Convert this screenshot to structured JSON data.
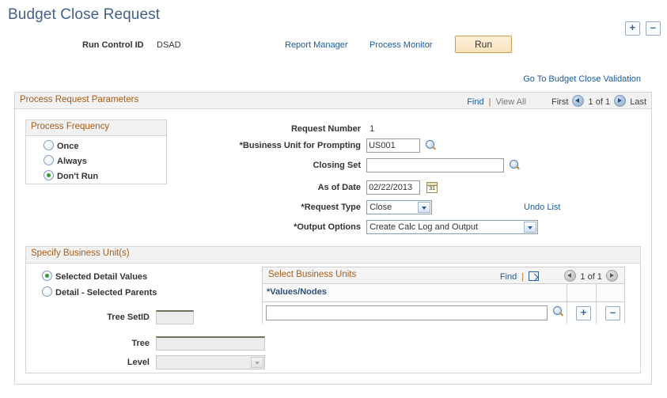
{
  "page": {
    "title": "Budget Close Request"
  },
  "toolbar": {
    "run_control_label": "Run Control ID",
    "run_control_value": "DSAD",
    "report_manager": "Report Manager",
    "process_monitor": "Process Monitor",
    "run_button": "Run",
    "goto_validation": "Go To Budget Close Validation"
  },
  "process_request": {
    "title": "Process Request Parameters",
    "find": "Find",
    "find_separator": "|",
    "view_all": "View All",
    "first": "First",
    "counter": "1 of 1",
    "last": "Last",
    "add_row": "+",
    "delete_row": "–"
  },
  "process_frequency": {
    "title": "Process Frequency",
    "options": [
      {
        "label": "Once",
        "selected": false
      },
      {
        "label": "Always",
        "selected": false
      },
      {
        "label": "Don't Run",
        "selected": true
      }
    ]
  },
  "fields": {
    "request_number_label": "Request Number",
    "request_number_value": "1",
    "business_unit_label": "Business Unit for Prompting",
    "business_unit_value": "US001",
    "closing_set_label": "Closing Set",
    "closing_set_value": "",
    "as_of_date_label": "As of Date",
    "as_of_date_value": "02/22/2013",
    "calendar_icon_text": "31",
    "request_type_label": "Request Type",
    "request_type_value": "Close",
    "output_options_label": "Output Options",
    "output_options_value": "Create Calc Log and Output",
    "undo_list": "Undo List"
  },
  "specify_business_units": {
    "title": "Specify Business Unit(s)",
    "options": [
      {
        "label": "Selected Detail Values",
        "selected": true
      },
      {
        "label": "Detail - Selected Parents",
        "selected": false
      }
    ],
    "tree_setid_label": "Tree SetID",
    "tree_setid_value": "",
    "tree_label": "Tree",
    "tree_value": "",
    "level_label": "Level",
    "level_value": ""
  },
  "select_business_units": {
    "title": "Select Business Units",
    "find": "Find",
    "find_separator": "|",
    "counter": "1 of 1",
    "column_header": "*Values/Nodes",
    "row_value": "",
    "add_row": "+",
    "delete_row": "–"
  },
  "colors": {
    "title_blue": "#44618b",
    "link_blue": "#1b5a9c",
    "section_header_brown": "#a85b16",
    "run_button_border": "#d79c4b",
    "radio_selected_green": "#2f9e2f"
  }
}
